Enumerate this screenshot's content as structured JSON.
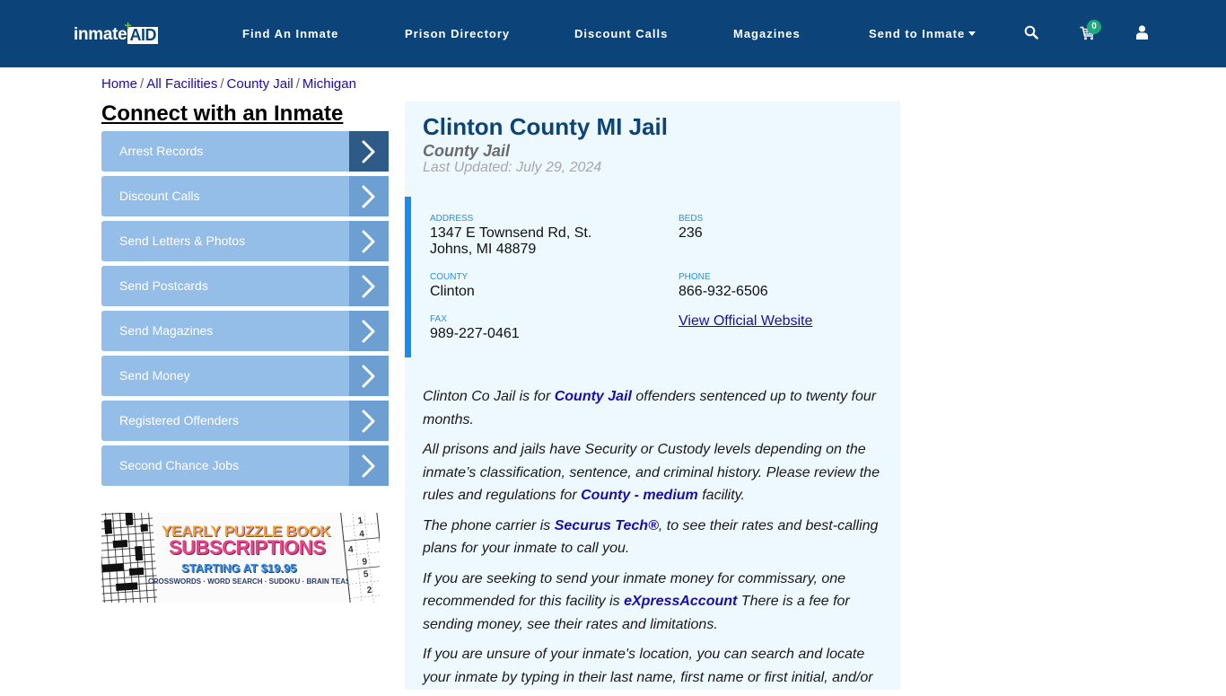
{
  "navbar": {
    "logo_text_1": "inmate",
    "logo_text_2": "AID",
    "logo_plus": "+",
    "links": [
      {
        "label": "Find An Inmate"
      },
      {
        "label": "Prison Directory"
      },
      {
        "label": "Discount Calls"
      },
      {
        "label": "Magazines"
      },
      {
        "label": "Send to Inmate"
      }
    ],
    "icons": {
      "search": "search-icon",
      "cart": "cart-icon",
      "user": "user-icon"
    },
    "cart_count": "0"
  },
  "breadcrumb": {
    "items": [
      "Home",
      "All Facilities",
      "County Jail",
      "Michigan"
    ],
    "separator": "/"
  },
  "sidebar": {
    "title": "Connect with an Inmate",
    "items": [
      {
        "label": "Arrest Records"
      },
      {
        "label": "Discount Calls"
      },
      {
        "label": "Send Letters & Photos"
      },
      {
        "label": "Send Postcards"
      },
      {
        "label": "Send Magazines"
      },
      {
        "label": "Send Money"
      },
      {
        "label": "Registered Offenders"
      },
      {
        "label": "Second Chance Jobs"
      }
    ],
    "ad": {
      "line1": "YEARLY PUZZLE BOOK",
      "line2": "SUBSCRIPTIONS",
      "line3": "STARTING AT $19.95",
      "line4": "CROSSWORDS · WORD SEARCH · SUDOKU · BRAIN TEASERS",
      "sudoku_digits": [
        "1",
        "4",
        "4",
        "9",
        "5",
        "2"
      ]
    }
  },
  "facility": {
    "name": "Clinton County MI Jail",
    "type": "County Jail",
    "last_updated": "Last Updated: July 29, 2024",
    "info": {
      "address_label": "ADDRESS",
      "address_line1": "1347 E Townsend Rd, St.",
      "address_line2": "Johns, MI 48879",
      "beds_label": "BEDS",
      "beds": "236",
      "county_label": "COUNTY",
      "county": "Clinton",
      "phone_label": "PHONE",
      "phone": "866-932-6506",
      "fax_label": "FAX",
      "fax": "989-227-0461",
      "website_link": "View Official Website"
    },
    "description": {
      "p1_a": "Clinton Co Jail is for ",
      "p1_link": "County Jail",
      "p1_b": " offenders sentenced up to twenty four months.",
      "p2_a": "All prisons and jails have Security or Custody levels depending on the inmate’s classification, sentence, and criminal history. Please review the rules and regulations for ",
      "p2_link": "County - medium",
      "p2_b": " facility.",
      "p3_a": "The phone carrier is ",
      "p3_link": "Securus Tech®",
      "p3_b": ", to see their rates and best-calling plans for your inmate to call you.",
      "p4_a": "If you are seeking to send your inmate money for commissary, one recommended for this facility is ",
      "p4_link": "eXpressAccount",
      "p4_b": " There is a fee for sending money, see their rates and limitations.",
      "p5": "If you are unsure of your inmate's location, you can search and locate your inmate by typing in their last name, first name or first initial, and/or"
    }
  },
  "colors": {
    "navbar_bg": "#0c4479",
    "sidebar_item": "#94bde8",
    "sidebar_arrow": "#6d9fd2",
    "sidebar_arrow_active": "#2e5a88",
    "panel_bg": "#eef8ff",
    "accent_bar": "#1a8cf0",
    "link": "#1a0dab",
    "cart_badge": "#1ea97c"
  }
}
